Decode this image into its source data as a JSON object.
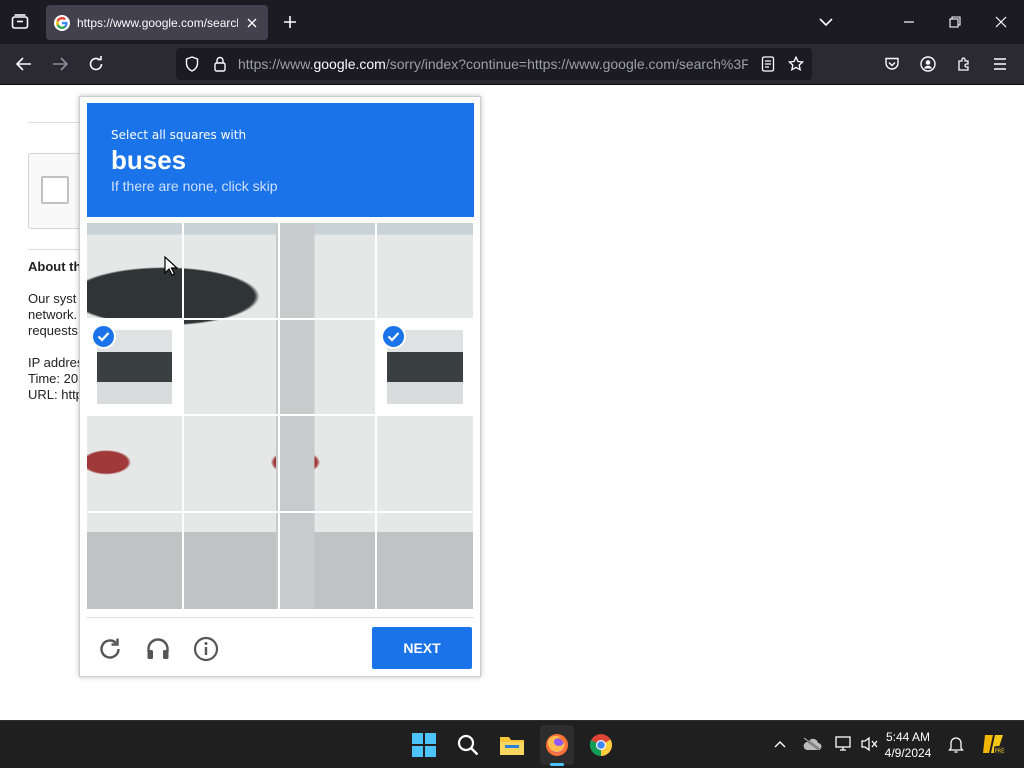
{
  "browser": {
    "tab_title": "https://www.google.com/search",
    "url_prefix": "https://www.",
    "url_host": "google.com",
    "url_rest": "/sorry/index?continue=https://www.google.com/search%3F"
  },
  "page": {
    "about_title": "About th",
    "about_lines": [
      "Our syst",
      "network.",
      "requests",
      "",
      "IP addres",
      "Time: 20",
      "URL: http"
    ]
  },
  "challenge": {
    "instruction": "Select all squares with",
    "target": "buses",
    "hint": "If there are none, click skip",
    "next_label": "NEXT",
    "selected_tiles": [
      4,
      7
    ],
    "accent": "#1a73e8"
  },
  "taskbar": {
    "time": "5:44 AM",
    "date": "4/9/2024"
  },
  "icons": {
    "tab_list": "tab-list-icon",
    "back": "back-arrow-icon",
    "forward": "forward-arrow-icon",
    "reload": "reload-icon",
    "shield": "shield-icon",
    "lock": "lock-icon",
    "reader": "reader-view-icon",
    "bookmark": "star-icon",
    "pocket": "pocket-icon",
    "account": "account-icon",
    "extensions": "extensions-icon",
    "menu": "hamburger-menu-icon",
    "audio": "headphones-icon",
    "info": "info-icon"
  }
}
